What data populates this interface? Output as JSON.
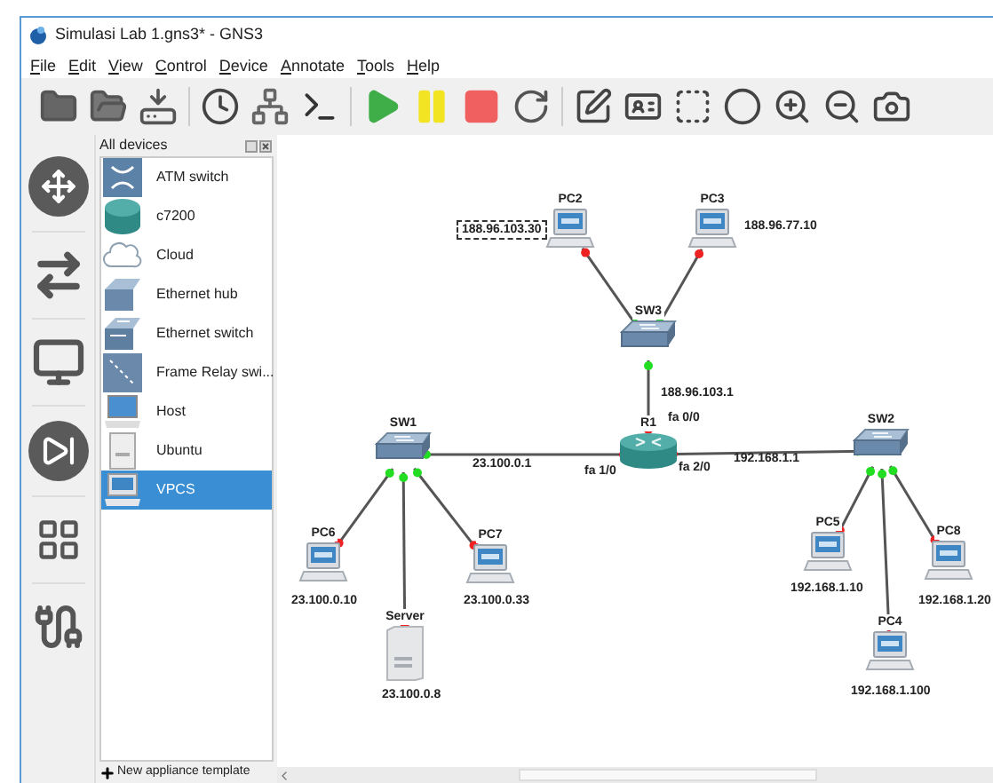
{
  "window": {
    "title": "Simulasi Lab 1.gns3* - GNS3"
  },
  "menu": [
    "File",
    "Edit",
    "View",
    "Control",
    "Device",
    "Annotate",
    "Tools",
    "Help"
  ],
  "device_panel": {
    "title": "All devices",
    "items": [
      {
        "label": "ATM switch",
        "kind": "atm",
        "selected": false
      },
      {
        "label": "c7200",
        "kind": "router",
        "selected": false
      },
      {
        "label": "Cloud",
        "kind": "cloud",
        "selected": false
      },
      {
        "label": "Ethernet hub",
        "kind": "hub",
        "selected": false
      },
      {
        "label": "Ethernet switch",
        "kind": "switch",
        "selected": false
      },
      {
        "label": "Frame Relay swi...",
        "kind": "frame",
        "selected": false
      },
      {
        "label": "Host",
        "kind": "host",
        "selected": false
      },
      {
        "label": "Ubuntu",
        "kind": "server",
        "selected": false
      },
      {
        "label": "VPCS",
        "kind": "vpcs",
        "selected": true
      }
    ],
    "footer": "New appliance template"
  },
  "topology": {
    "nodes": [
      {
        "label": "PC2",
        "kind": "pc"
      },
      {
        "label": "PC3",
        "kind": "pc"
      },
      {
        "label": "SW3",
        "kind": "switch"
      },
      {
        "label": "SW1",
        "kind": "switch"
      },
      {
        "label": "R1",
        "kind": "router"
      },
      {
        "label": "SW2",
        "kind": "switch"
      },
      {
        "label": "PC6",
        "kind": "pc"
      },
      {
        "label": "PC7",
        "kind": "pc"
      },
      {
        "label": "PC5",
        "kind": "pc"
      },
      {
        "label": "PC8",
        "kind": "pc"
      },
      {
        "label": "Server",
        "kind": "server"
      },
      {
        "label": "PC4",
        "kind": "pc"
      }
    ],
    "links": [
      {
        "from_up": false,
        "to_up": true
      },
      {
        "from_up": false,
        "to_up": true
      },
      {
        "from_up": true,
        "to_up": false
      },
      {
        "from_up": false,
        "to_up": true
      },
      {
        "from_up": false,
        "to_up": true
      },
      {
        "from_up": true,
        "to_up": false
      },
      {
        "from_up": true,
        "to_up": false
      },
      {
        "from_up": true,
        "to_up": false
      },
      {
        "from_up": true,
        "to_up": false
      },
      {
        "from_up": true,
        "to_up": false
      },
      {
        "from_up": true,
        "to_up": false
      }
    ],
    "notes": [
      {
        "text": "188.96.103.30",
        "selected": true
      },
      {
        "text": "188.96.77.10",
        "selected": false
      },
      {
        "text": "188.96.103.1",
        "selected": false
      },
      {
        "text": "fa 0/0",
        "selected": false
      },
      {
        "text": "23.100.0.1",
        "selected": false
      },
      {
        "text": "fa 1/0",
        "selected": false
      },
      {
        "text": "fa 2/0",
        "selected": false
      },
      {
        "text": "192.168.1.1",
        "selected": false
      },
      {
        "text": "23.100.0.10",
        "selected": false
      },
      {
        "text": "23.100.0.8",
        "selected": false
      },
      {
        "text": "23.100.0.33",
        "selected": false
      },
      {
        "text": "192.168.1.10",
        "selected": false
      },
      {
        "text": "192.168.1.20",
        "selected": false
      },
      {
        "text": "192.168.1.100",
        "selected": false
      }
    ]
  }
}
